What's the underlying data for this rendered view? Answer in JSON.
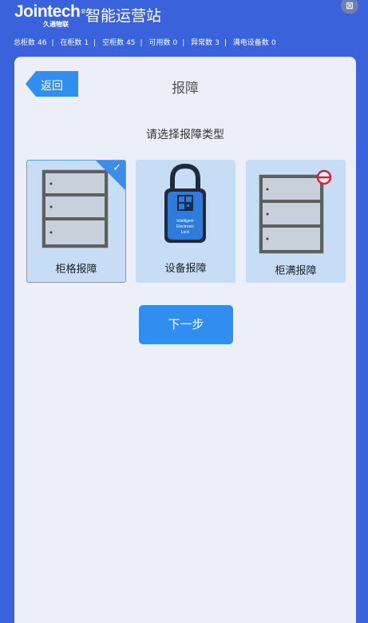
{
  "header": {
    "logo_text": "Jointech",
    "logo_reg": "®",
    "logo_sub": "久通物联",
    "app_title": "智能运营站",
    "close_symbol": "⊠"
  },
  "stats": [
    {
      "label": "总柜数",
      "value": "46"
    },
    {
      "label": "在柜数",
      "value": "1"
    },
    {
      "label": "空柜数",
      "value": "45"
    },
    {
      "label": "可用数",
      "value": "0"
    },
    {
      "label": "异常数",
      "value": "3"
    },
    {
      "label": "满电设备数",
      "value": "0"
    }
  ],
  "stats_separator": "|",
  "nav": {
    "back_label": "返回",
    "page_title": "报障"
  },
  "prompt": "请选择报障类型",
  "options": [
    {
      "label": "柜格报障",
      "icon": "cabinet-grid-icon",
      "selected": true
    },
    {
      "label": "设备报障",
      "icon": "electronic-lock-icon",
      "selected": false,
      "lock_text": [
        "Intelligent",
        "Electronic",
        "Lock"
      ]
    },
    {
      "label": "柜满报障",
      "icon": "cabinet-full-icon",
      "selected": false
    }
  ],
  "next_label": "下一步",
  "colors": {
    "background": "#3a62dc",
    "panel": "#eceff7",
    "card": "#c7ddf6",
    "accent": "#2f8ef0",
    "alert": "#e01e3c"
  }
}
